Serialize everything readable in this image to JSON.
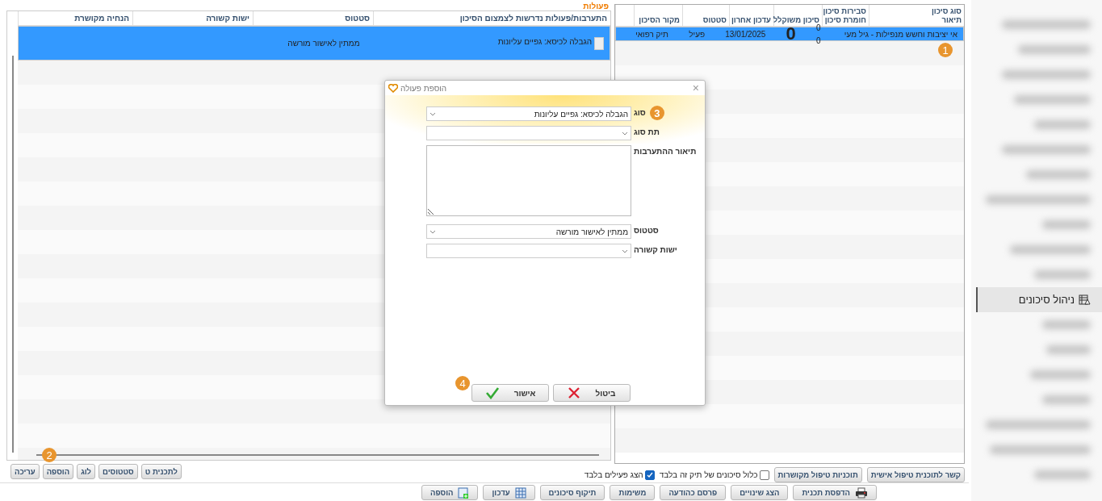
{
  "actions_panel": {
    "title": "פעולות",
    "callout": "2",
    "columns": [
      "התערבות/פעולות נדרשות לצמצום הסיכון",
      "סטטוס",
      "ישות קשורה",
      "הנחיה מקושרת"
    ],
    "rows": [
      {
        "intervention": "הגבלה לכיסא: גפיים עליונות",
        "status": "ממתין לאישור מורשה",
        "selected": true
      }
    ],
    "buttons": [
      "לתכנית ט",
      "סטטוסים",
      "לוג",
      "הוספה",
      "עריכה"
    ]
  },
  "risks_panel": {
    "callout": "1",
    "columns": [
      [
        "סוג סיכון",
        "תיאור"
      ],
      [
        "סבירות סיכון",
        "חומרת סיכון"
      ],
      [
        "סיכון משוקלל"
      ],
      [
        "עדכון אחרון"
      ],
      [
        "סטטוס"
      ],
      [
        "מקור הסיכון"
      ]
    ],
    "rows": [
      {
        "description": "אי יציבות וחשש מנפילות - גיל מעי",
        "likelihood": "0",
        "severity": "0",
        "weighted": "0",
        "updated": "13/01/2025",
        "status": "פעיל",
        "source": "תיק רפואי",
        "selected": true
      }
    ],
    "buttons": [
      "קשר לתוכנית טיפול אישית",
      "תוכניות טיפול מקושרות"
    ],
    "checkboxes": [
      {
        "label": "כלול סיכונים של תיק זה בלבד",
        "checked": false
      },
      {
        "label": "הצג פעילים בלבד",
        "checked": true
      }
    ]
  },
  "toolbar": [
    {
      "label": "הדפסת תכנית",
      "kind": "printer"
    },
    {
      "label": "הצג שינויים",
      "kind": "plain"
    },
    {
      "label": "פרסם כהודעה",
      "kind": "plain"
    },
    {
      "label": "משימות",
      "kind": "plain"
    },
    {
      "label": "תיקוף סיכונים",
      "kind": "plain"
    },
    {
      "label": "עדכון",
      "kind": "grid"
    },
    {
      "label": "הוספה",
      "kind": "add"
    }
  ],
  "dialog": {
    "title": "הוספת פעולה",
    "close": "×",
    "fields": [
      {
        "label": "סוג",
        "kind": "select",
        "value": "הגבלה לכיסא: גפיים עליונות",
        "callout": "3"
      },
      {
        "label": "תת סוג",
        "kind": "select"
      },
      {
        "label": "תיאור ההתערבות",
        "kind": "textarea"
      },
      {
        "label": "סטטוס",
        "kind": "select",
        "value": "ממתין לאישור מורשה"
      },
      {
        "label": "ישות קשורה",
        "kind": "select"
      }
    ],
    "buttons": [
      {
        "label": "ביטול",
        "kind": "cancel"
      },
      {
        "label": "אישור",
        "kind": "ok",
        "callout": "4"
      }
    ]
  },
  "sidebar": {
    "items": [
      {
        "kind": "blurred",
        "selected": false
      },
      {
        "kind": "blurred",
        "selected": false
      },
      {
        "kind": "blurred",
        "selected": false
      },
      {
        "kind": "blurred",
        "selected": false
      },
      {
        "kind": "blurred",
        "selected": false
      },
      {
        "kind": "blurred",
        "selected": false
      },
      {
        "kind": "blurred",
        "selected": false
      },
      {
        "kind": "blurred",
        "selected": false
      },
      {
        "kind": "blurred",
        "selected": false
      },
      {
        "kind": "blurred",
        "selected": false
      },
      {
        "kind": "blurred",
        "selected": false
      },
      {
        "kind": "item",
        "label": "ניהול סיכונים",
        "selected": true
      },
      {
        "kind": "blurred",
        "selected": false
      },
      {
        "kind": "blurred",
        "selected": false
      },
      {
        "kind": "blurred",
        "selected": false
      },
      {
        "kind": "blurred",
        "selected": false
      },
      {
        "kind": "blurred",
        "selected": false
      },
      {
        "kind": "blurred",
        "selected": false
      },
      {
        "kind": "blurred",
        "selected": false
      }
    ]
  }
}
